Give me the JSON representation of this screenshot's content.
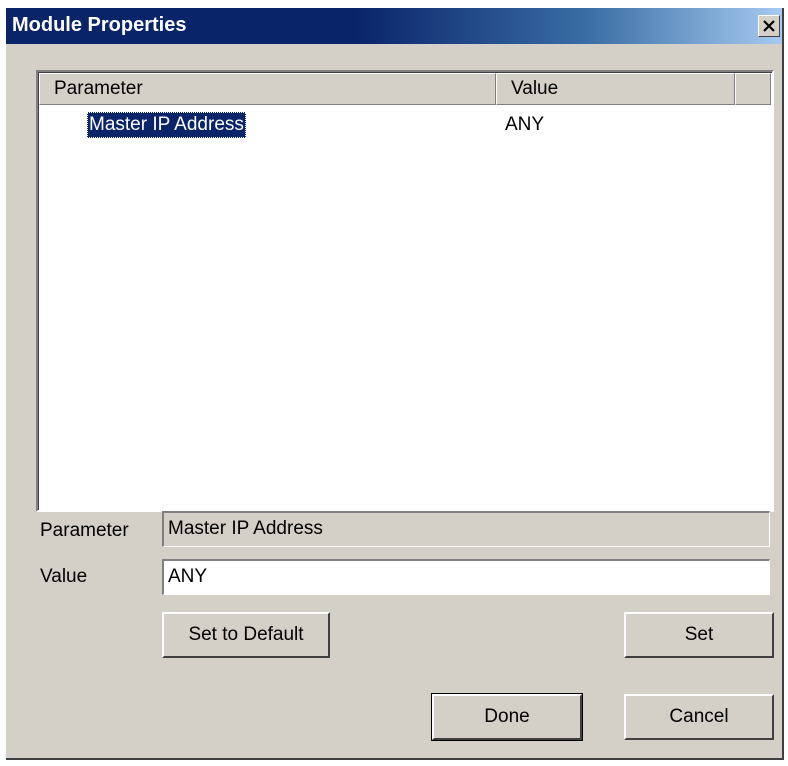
{
  "window": {
    "title": "Module Properties",
    "close_glyph": "✕"
  },
  "listview": {
    "columns": [
      "Parameter",
      "Value"
    ],
    "rows": [
      {
        "parameter": "Master IP Address",
        "value": "ANY",
        "selected": true
      }
    ]
  },
  "form": {
    "parameter_label": "Parameter",
    "parameter_value": "Master IP Address",
    "value_label": "Value",
    "value_value": "ANY"
  },
  "buttons": {
    "set_to_default": "Set to Default",
    "set": "Set",
    "done": "Done",
    "cancel": "Cancel"
  },
  "colors": {
    "title_bar": "#0a246a",
    "selection": "#0a246a",
    "face": "#d4d0c8"
  }
}
